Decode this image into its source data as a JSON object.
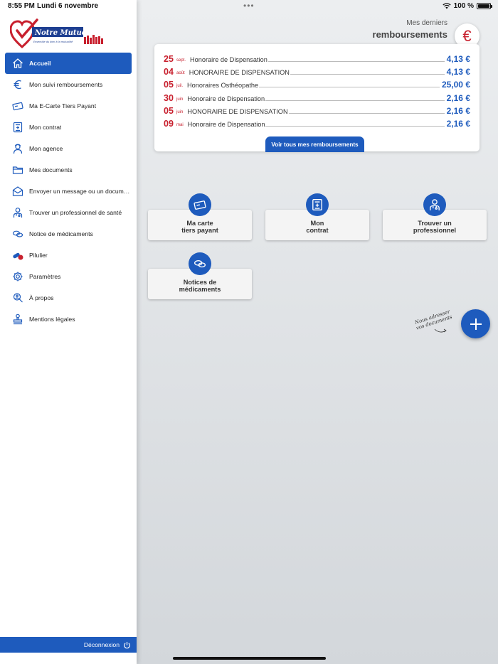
{
  "status": {
    "time": "8:55 PM",
    "date": "Lundi 6 novembre",
    "battery": "100 %"
  },
  "logo": {
    "name": "Notre Mutuelle",
    "tagline": "Ensemble du bien à la mutualité"
  },
  "sidebar": {
    "items": [
      {
        "label": "Accueil",
        "icon": "home-icon"
      },
      {
        "label": "Mon suivi remboursements",
        "icon": "euro-icon"
      },
      {
        "label": "Ma E-Carte Tiers Payant",
        "icon": "card-icon"
      },
      {
        "label": "Mon contrat",
        "icon": "contract-icon"
      },
      {
        "label": "Mon agence",
        "icon": "agent-icon"
      },
      {
        "label": "Mes documents",
        "icon": "folder-icon"
      },
      {
        "label": "Envoyer un message ou un docum…",
        "icon": "mail-icon"
      },
      {
        "label": "Trouver un professionnel de santé",
        "icon": "doctor-icon"
      },
      {
        "label": "Notice de médicaments",
        "icon": "pills-icon"
      },
      {
        "label": "Pilulier",
        "icon": "pill-box-icon"
      },
      {
        "label": "Paramètres",
        "icon": "gear-icon"
      },
      {
        "label": "À propos",
        "icon": "search-person-icon"
      },
      {
        "label": "Mentions légales",
        "icon": "stamp-icon"
      }
    ],
    "logout_label": "Déconnexion"
  },
  "reimbursements": {
    "subtitle": "Mes derniers",
    "title": "remboursements",
    "rows": [
      {
        "day": "25",
        "month": "sept.",
        "label": "Honoraire de Dispensation",
        "amount": "4,13 €"
      },
      {
        "day": "04",
        "month": "août",
        "label": "HONORAIRE DE DISPENSATION",
        "amount": "4,13 €"
      },
      {
        "day": "05",
        "month": "juil.",
        "label": "Honoraires Osthéopathe",
        "amount": "25,00 €"
      },
      {
        "day": "30",
        "month": "juin",
        "label": "Honoraire de Dispensation",
        "amount": "2,16 €"
      },
      {
        "day": "05",
        "month": "juin",
        "label": "HONORAIRE DE DISPENSATION",
        "amount": "2,16 €"
      },
      {
        "day": "09",
        "month": "mai",
        "label": "Honoraire de Dispensation",
        "amount": "2,16 €"
      }
    ],
    "see_all_label": "Voir tous mes remboursements"
  },
  "tiles": [
    {
      "line1": "Ma carte",
      "line2": "tiers payant",
      "icon": "card-icon"
    },
    {
      "line1": "Mon",
      "line2": "contrat",
      "icon": "contract-icon"
    },
    {
      "line1": "Trouver un",
      "line2": "professionnel",
      "icon": "doctor-icon"
    },
    {
      "line1": "Notices de",
      "line2": "médicaments",
      "icon": "pills-icon"
    }
  ],
  "fab": {
    "note_line1": "Nous adresser",
    "note_line2": "vos documents",
    "icon": "plus-icon"
  },
  "colors": {
    "primary": "#1e5bbd",
    "accent": "#c8202e"
  }
}
